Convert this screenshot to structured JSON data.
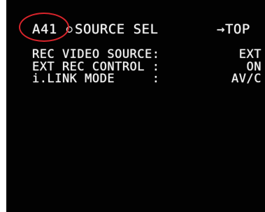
{
  "menu": {
    "code": "A41",
    "separator": "○",
    "title": "SOURCE SEL",
    "top_link": "→TOP"
  },
  "rows": [
    {
      "label": "REC VIDEO SOURCE:",
      "value": "EXT"
    },
    {
      "label": "EXT REC CONTROL :",
      "value": "ON"
    },
    {
      "label": "i.LINK MODE     :",
      "value": "AV/C"
    }
  ],
  "colors": {
    "background": "#020202",
    "text": "#f2f2f2",
    "annotation_circle": "#d8242b"
  }
}
